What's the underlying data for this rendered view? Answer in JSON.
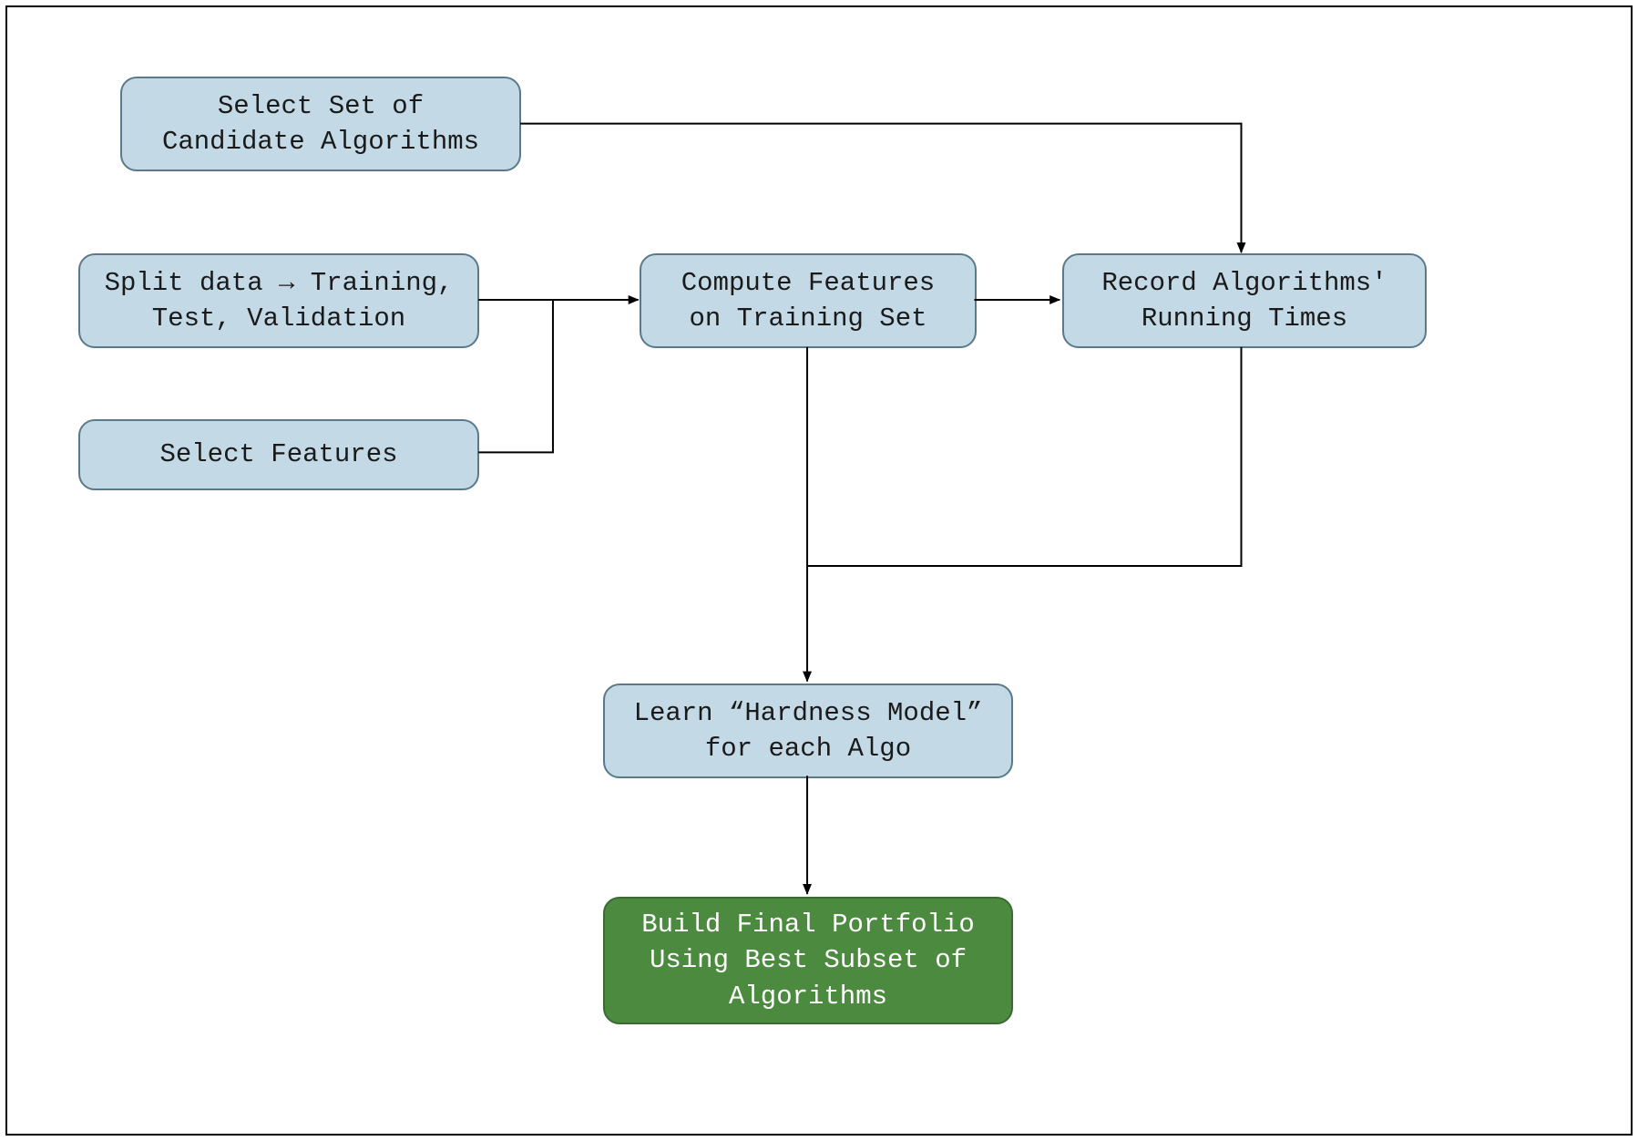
{
  "nodes": {
    "select_algos": "Select Set of\nCandidate Algorithms",
    "split_data": "Split data → Training,\nTest, Validation",
    "select_features": "Select Features",
    "compute_features": "Compute Features\non Training Set",
    "record_times": "Record Algorithms'\nRunning Times",
    "learn_model": "Learn “Hardness Model”\nfor each Algo",
    "build_portfolio": "Build Final Portfolio\nUsing Best Subset of\nAlgorithms"
  },
  "colors": {
    "blue_fill": "#c3d9e6",
    "blue_stroke": "#5a7a8a",
    "green_fill": "#4c8a3f",
    "green_stroke": "#3a6a30"
  }
}
